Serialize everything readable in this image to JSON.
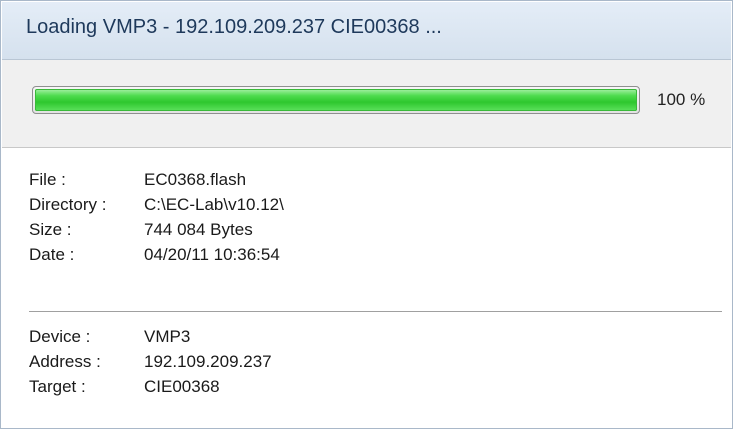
{
  "window": {
    "title": "Loading VMP3 - 192.109.209.237 CIE00368 ..."
  },
  "progress": {
    "value_percent": 100,
    "percent_label": "100 %"
  },
  "file_info": [
    {
      "label": "File :",
      "value": "EC0368.flash"
    },
    {
      "label": "Directory :",
      "value": "C:\\EC-Lab\\v10.12\\"
    },
    {
      "label": "Size :",
      "value": "744 084 Bytes"
    },
    {
      "label": "Date :",
      "value": "04/20/11 10:36:54"
    }
  ],
  "device_info": [
    {
      "label": "Device :",
      "value": "VMP3"
    },
    {
      "label": "Address :",
      "value": "192.109.209.237"
    },
    {
      "label": "Target :",
      "value": "CIE00368"
    }
  ],
  "colors": {
    "progress_fill": "#2ec72e",
    "title_bar": "#dbe6f2",
    "panel_bg": "#f0f0f0"
  }
}
